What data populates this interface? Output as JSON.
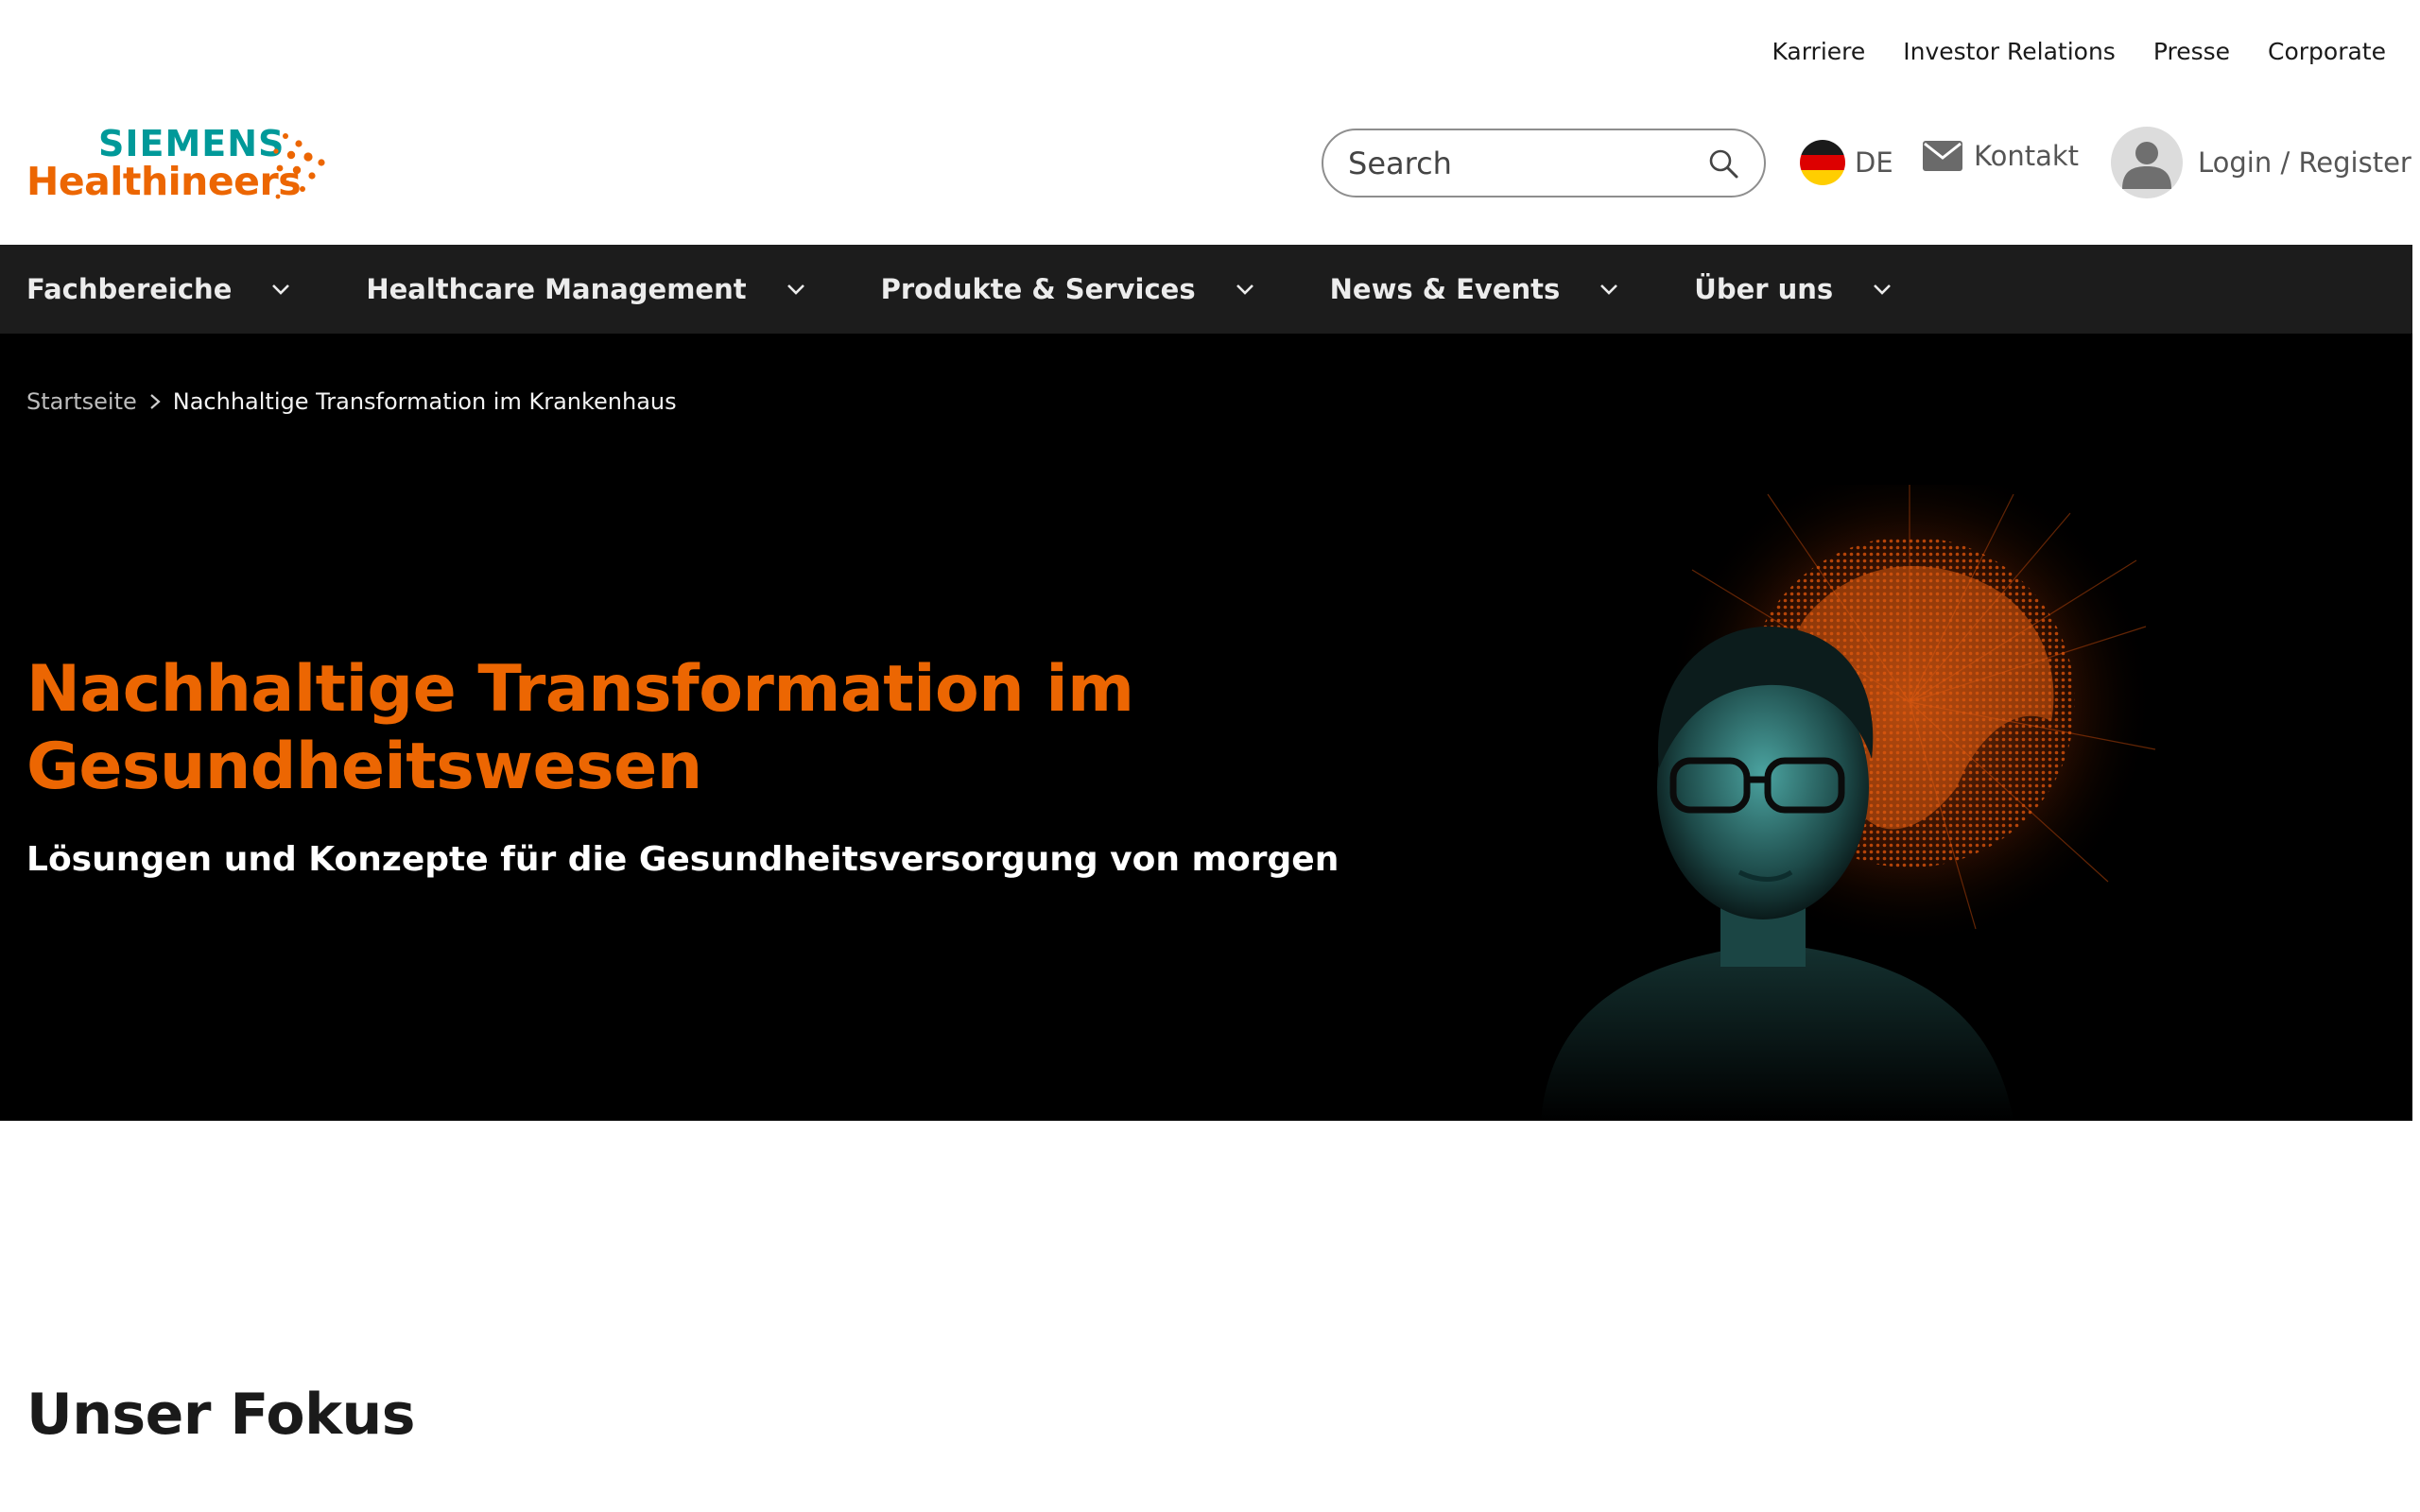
{
  "utility_nav": [
    "Karriere",
    "Investor Relations",
    "Presse",
    "Corporate"
  ],
  "logo": {
    "line1": "SIEMENS",
    "line2": "Healthineers"
  },
  "search": {
    "placeholder": "Search"
  },
  "language": {
    "label": "DE"
  },
  "contact": {
    "label": "Kontakt"
  },
  "account": {
    "label": "Login / Register"
  },
  "main_nav": [
    {
      "label": "Fachbereiche"
    },
    {
      "label": "Healthcare Management"
    },
    {
      "label": "Produkte & Services"
    },
    {
      "label": "News & Events"
    },
    {
      "label": "Über uns"
    }
  ],
  "breadcrumb": {
    "home": "Startseite",
    "current": "Nachhaltige Transformation im Krankenhaus"
  },
  "hero": {
    "title_line1": "Nachhaltige Transformation im",
    "title_line2": "Gesundheitswesen",
    "subtitle": "Lösungen und Konzepte für die Gesundheitsversorgung von morgen"
  },
  "section": {
    "title": "Unser Fokus"
  },
  "colors": {
    "brand_orange": "#ec6602",
    "brand_teal": "#009999",
    "nav_bg": "#1c1c1c",
    "hero_bg": "#000000"
  },
  "icons": [
    "search-icon",
    "flag-de-icon",
    "mail-icon",
    "user-icon",
    "chevron-down-icon",
    "chevron-right-icon"
  ]
}
